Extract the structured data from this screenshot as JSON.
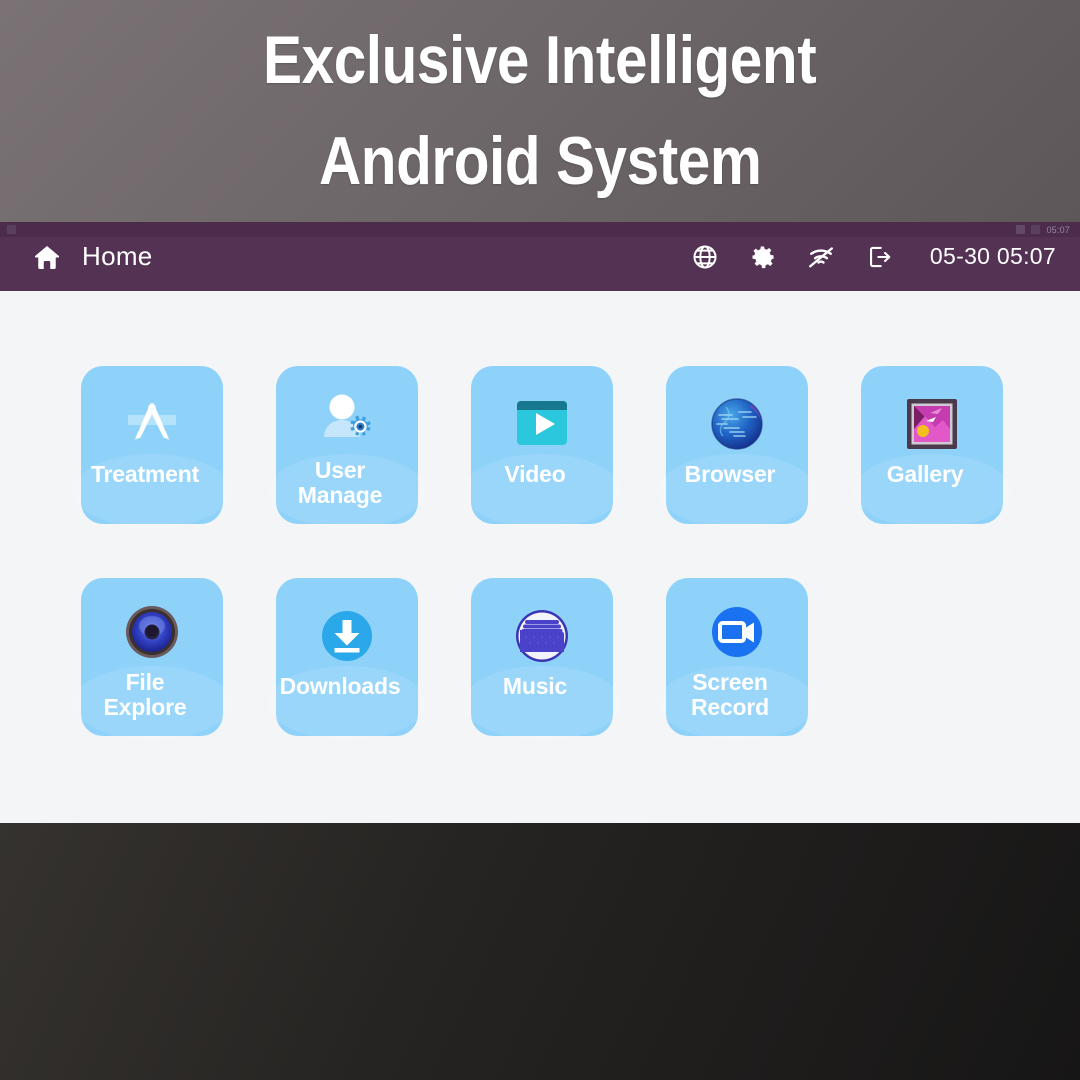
{
  "banner": {
    "line1": "Exclusive Intelligent",
    "line2": "Android System"
  },
  "micro_status": {
    "time": "05:07"
  },
  "appbar": {
    "home_label": "Home",
    "home_icon": "home-icon",
    "clock": "05-30 05:07",
    "icons": [
      {
        "name": "globe-icon",
        "label": "Language"
      },
      {
        "name": "gear-icon",
        "label": "Settings"
      },
      {
        "name": "wifi-off-icon",
        "label": "Wi-Fi disconnected"
      },
      {
        "name": "logout-icon",
        "label": "Exit"
      }
    ]
  },
  "colors": {
    "banner_bg": "#6e6769",
    "appbar_bg": "#533253",
    "content_bg": "#f4f5f7",
    "tile_bg": "#8ed2fa",
    "tile_label": "#ffffff",
    "bottom_bg": "#262422"
  },
  "apps": [
    {
      "label": "Treatment",
      "icon": "app-store-icon",
      "lines": 1
    },
    {
      "label": "User\nManage",
      "icon": "user-gear-icon",
      "lines": 2
    },
    {
      "label": "Video",
      "icon": "video-player-icon",
      "lines": 1
    },
    {
      "label": "Browser",
      "icon": "globe-sphere-icon",
      "lines": 1
    },
    {
      "label": "Gallery",
      "icon": "framed-photo-icon",
      "lines": 1
    },
    {
      "label": "File\nExplore",
      "icon": "speaker-icon",
      "lines": 2
    },
    {
      "label": "Downloads",
      "icon": "download-icon",
      "lines": 1
    },
    {
      "label": "Music",
      "icon": "folder-stack-icon",
      "lines": 1
    },
    {
      "label": "Screen\nRecord",
      "icon": "video-camera-icon",
      "lines": 2
    }
  ]
}
